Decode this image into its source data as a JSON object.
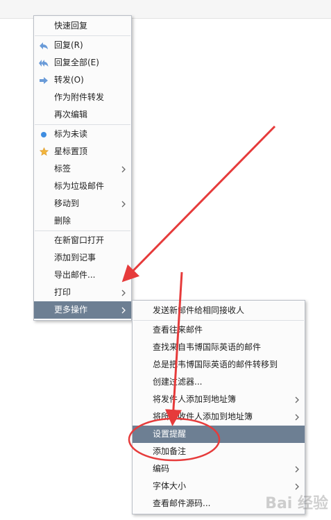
{
  "main_menu": {
    "items": [
      {
        "label": "快速回复"
      },
      {
        "label": "回复(R)",
        "icon": "reply-icon"
      },
      {
        "label": "回复全部(E)",
        "icon": "reply-all-icon"
      },
      {
        "label": "转发(O)",
        "icon": "forward-icon"
      },
      {
        "label": "作为附件转发"
      },
      {
        "label": "再次编辑"
      },
      {
        "label": "标为未读",
        "icon": "unread-dot-icon"
      },
      {
        "label": "星标置顶",
        "icon": "star-icon"
      },
      {
        "label": "标签",
        "submenu": true
      },
      {
        "label": "标为垃圾邮件"
      },
      {
        "label": "移动到",
        "submenu": true
      },
      {
        "label": "删除"
      },
      {
        "label": "在新窗口打开"
      },
      {
        "label": "添加到记事"
      },
      {
        "label": "导出邮件..."
      },
      {
        "label": "打印",
        "submenu": true
      },
      {
        "label": "更多操作",
        "submenu": true,
        "highlighted": true
      }
    ]
  },
  "sub_menu": {
    "items": [
      {
        "label": "发送新邮件给相同接收人"
      },
      {
        "label": "查看往来邮件"
      },
      {
        "label": "查找来自韦博国际英语的邮件"
      },
      {
        "label": "总是把韦博国际英语的邮件转移到"
      },
      {
        "label": "创建过滤器..."
      },
      {
        "label": "将发件人添加到地址簿",
        "submenu": true
      },
      {
        "label": "将所有收件人添加到地址簿",
        "submenu": true
      },
      {
        "label": "设置提醒",
        "highlighted": true
      },
      {
        "label": "添加备注"
      },
      {
        "label": "编码",
        "submenu": true
      },
      {
        "label": "字体大小",
        "submenu": true
      },
      {
        "label": "查看邮件源码..."
      }
    ]
  },
  "colors": {
    "highlight": "#6d7f93",
    "annotation_red": "#e63b3b",
    "reply_icon": "#6a9bd8",
    "unread_dot": "#3f8de0",
    "star": "#f2b53a"
  },
  "watermark": "Bai 经验"
}
